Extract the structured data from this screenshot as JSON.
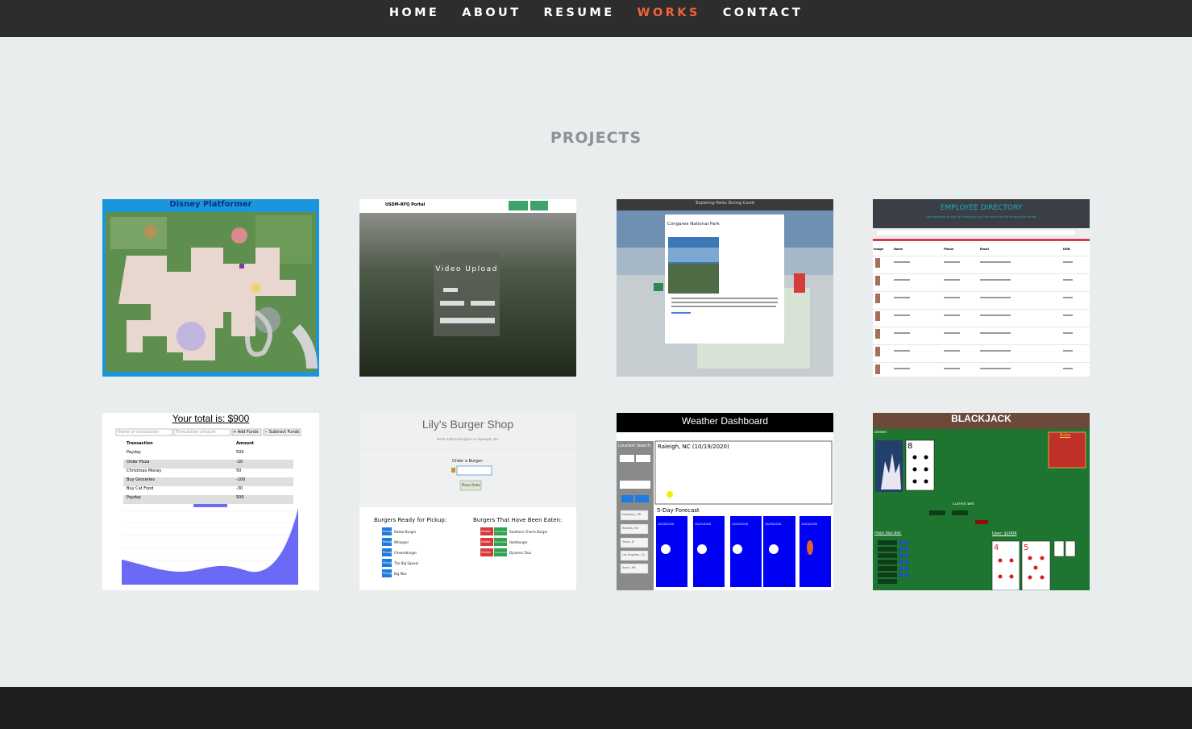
{
  "nav": {
    "items": [
      {
        "label": "HOME",
        "active": false
      },
      {
        "label": "ABOUT",
        "active": false
      },
      {
        "label": "RESUME",
        "active": false
      },
      {
        "label": "WORKS",
        "active": true
      },
      {
        "label": "CONTACT",
        "active": false
      }
    ]
  },
  "section": {
    "title": "PROJECTS"
  },
  "colors": {
    "nav_bg": "#2d2d2d",
    "active": "#f0623b",
    "page_bg": "#e9edee",
    "footer_bg": "#1e1e1e"
  },
  "projects": {
    "p1": {
      "title": "Disney Platformer"
    },
    "p2": {
      "title": "Video Upload",
      "brand": "USDM-RFQ Portal"
    },
    "p3": {
      "title": "Exploring Parks During Covid",
      "modal_title": "Congaree National Park"
    },
    "p4": {
      "title": "EMPLOYEE DIRECTORY",
      "subtitle": "Use dropdown to sort by heading or use the search box to narrow your results",
      "columns": [
        "Image",
        "Name",
        "Phone",
        "Email",
        "DOB"
      ]
    },
    "p5": {
      "title": "Your total is: $900",
      "name_placeholder": "Name of transaction",
      "amount_placeholder": "Transaction amount",
      "add_label": "+ Add Funds",
      "sub_label": "− Subtract Funds",
      "columns": [
        "Transaction",
        "Amount"
      ],
      "rows": [
        [
          "Payday",
          "500"
        ],
        [
          "Order Pizza",
          "-20"
        ],
        [
          "Christmas Money",
          "50"
        ],
        [
          "Buy Groceries",
          "-100"
        ],
        [
          "Buy Cat Food",
          "-30"
        ],
        [
          "Payday",
          "500"
        ]
      ]
    },
    "p6": {
      "title": "Lily's Burger Shop",
      "subtitle": "Best Rated Burgers in Raleigh, NC",
      "order_label": "Order a Burger:",
      "order_button": "Place Order",
      "ready_heading": "Burgers Ready for Pickup:",
      "eaten_heading": "Burgers That Have Been Eaten:",
      "ready": [
        "Rodeo Burger",
        "Whopper",
        "Cheeseburger",
        "The Big Squeal",
        "Big Mac"
      ],
      "eaten": [
        "Southern Charm Burger",
        "Hamburger",
        "Dynamic Duo"
      ],
      "pickup_label": "Pickup",
      "delete_label": "Delete",
      "devour_label": "Devoured"
    },
    "p7": {
      "title": "Weather Dashboard",
      "search_label": "Location Search:",
      "city": "Raleigh, NC (10/19/2020)",
      "forecast_label": "5-Day Forecast",
      "dates": [
        "10/20/2020",
        "10/21/2020",
        "10/22/2020",
        "10/23/2020",
        "10/24/2020"
      ],
      "cities": [
        "Newburg, OR",
        "Raleigh, NC",
        "Tokyo, JP",
        "Los Angeles, CA",
        "Seoul, KR"
      ]
    },
    "p8": {
      "title": "BLACKJACK",
      "rules_label": "Rules",
      "dealer_label": "Dealer:",
      "bet_label": "Current Bet:",
      "place_bet_label": "Place Your Bet:",
      "user_label": "User: $1004"
    }
  }
}
